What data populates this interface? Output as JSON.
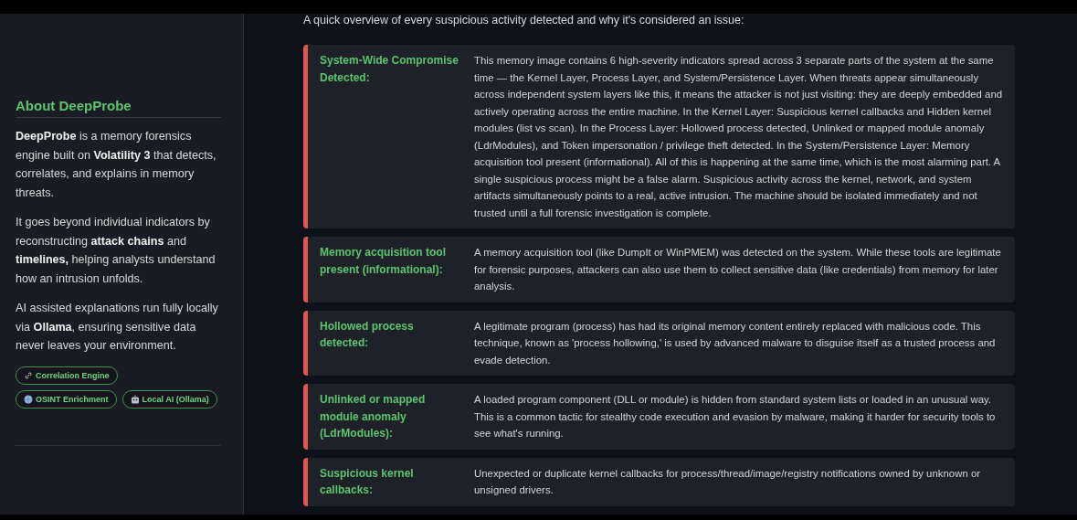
{
  "sidebar": {
    "heading": "About DeepProbe",
    "paragraphs": [
      "**DeepProbe** is a memory forensics engine built on **Volatility 3** that detects, correlates, and explains in memory threats.",
      "It goes beyond individual indicators by reconstructing **attack chains** and **timelines,** helping analysts understand how an intrusion unfolds.",
      "AI assisted explanations run fully locally via **Ollama**, ensuring sensitive data never leaves your environment."
    ],
    "badges": [
      {
        "kind": "link",
        "label": "Correlation Engine"
      },
      {
        "kind": "globe",
        "label": "OSINT Enrichment"
      },
      {
        "kind": "robot",
        "label": "Local AI (Ollama)"
      }
    ]
  },
  "main": {
    "intro": "A quick overview of every suspicious activity detected and why it's considered an issue:",
    "findings": [
      {
        "title": "System-Wide Compromise Detected:",
        "description": "This memory image contains 6 high-severity indicators spread across 3 separate parts of the system at the same time — the Kernel Layer, Process Layer, and System/Persistence Layer. When threats appear simultaneously across independent system layers like this, it means the attacker is not just visiting: they are deeply embedded and actively operating across the entire machine. In the Kernel Layer: Suspicious kernel callbacks and Hidden kernel modules (list vs scan). In the Process Layer: Hollowed process detected, Unlinked or mapped module anomaly (LdrModules), and Token impersonation / privilege theft detected. In the System/Persistence Layer: Memory acquisition tool present (informational). All of this is happening at the same time, which is the most alarming part. A single suspicious process might be a false alarm. Suspicious activity across the kernel, network, and system artifacts simultaneously points to a real, active intrusion. The machine should be isolated immediately and not trusted until a full forensic investigation is complete."
      },
      {
        "title": "Memory acquisition tool present (informational):",
        "description": "A memory acquisition tool (like DumpIt or WinPMEM) was detected on the system. While these tools are legitimate for forensic purposes, attackers can also use them to collect sensitive data (like credentials) from memory for later analysis."
      },
      {
        "title": "Hollowed process detected:",
        "description": "A legitimate program (process) has had its original memory content entirely replaced with malicious code. This technique, known as 'process hollowing,' is used by advanced malware to disguise itself as a trusted process and evade detection."
      },
      {
        "title": "Unlinked or mapped module anomaly (LdrModules):",
        "description": "A loaded program component (DLL or module) is hidden from standard system lists or loaded in an unusual way. This is a common tactic for stealthy code execution and evasion by malware, making it harder for security tools to see what's running."
      },
      {
        "title": "Suspicious kernel callbacks:",
        "description": "Unexpected or duplicate kernel callbacks for process/thread/image/registry notifications owned by unknown or unsigned drivers."
      }
    ]
  }
}
